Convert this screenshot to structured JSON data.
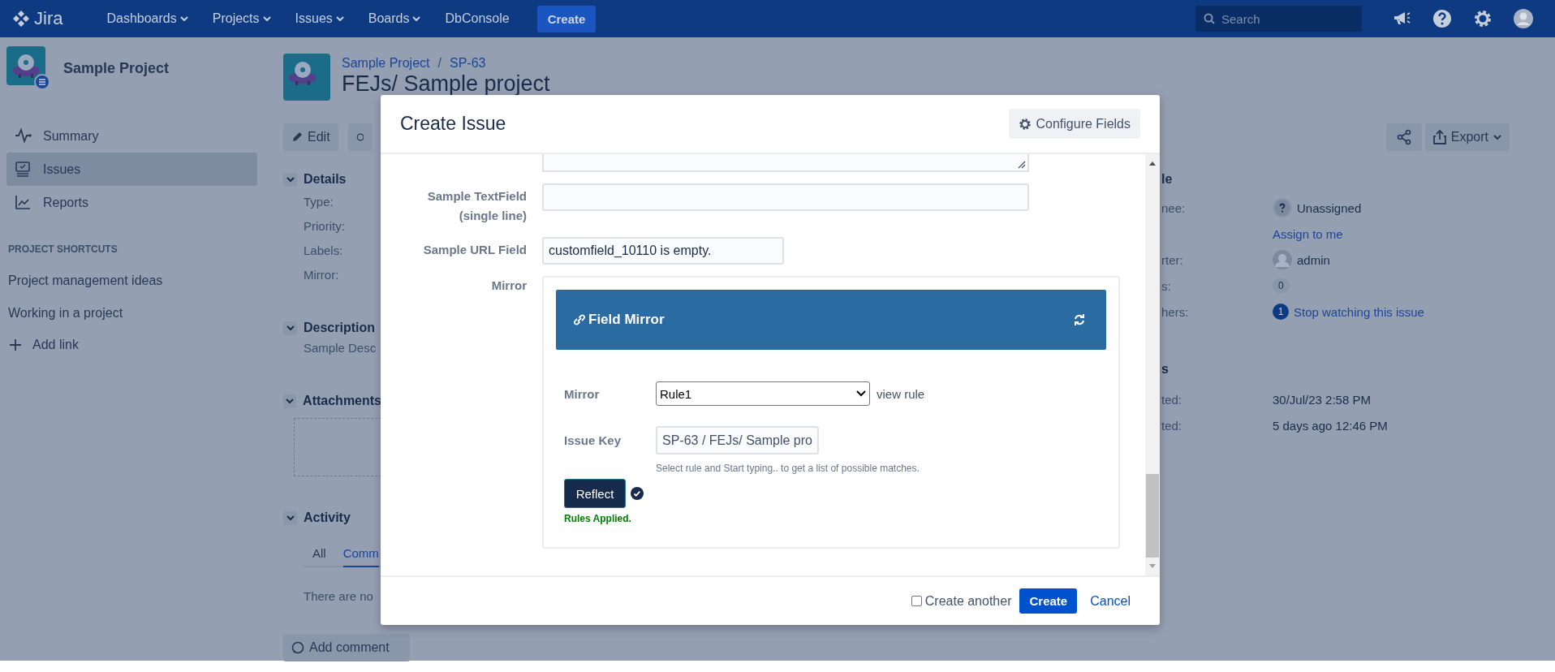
{
  "topbar": {
    "logo": "Jira",
    "nav": [
      {
        "label": "Dashboards",
        "dropdown": true
      },
      {
        "label": "Projects",
        "dropdown": true
      },
      {
        "label": "Issues",
        "dropdown": true
      },
      {
        "label": "Boards",
        "dropdown": true
      },
      {
        "label": "DbConsole",
        "dropdown": false
      }
    ],
    "create": "Create",
    "search": {
      "placeholder": "Search"
    }
  },
  "sidebar": {
    "project": "Sample Project",
    "items": [
      {
        "kind": "summary",
        "label": "Summary",
        "selected": false
      },
      {
        "kind": "issues",
        "label": "Issues",
        "selected": true
      },
      {
        "kind": "reports",
        "label": "Reports",
        "selected": false
      }
    ],
    "shortcuts_heading": "PROJECT SHORTCUTS",
    "shortcuts": [
      "Project management ideas",
      "Working in a project"
    ],
    "add_link": "Add link"
  },
  "issue": {
    "breadcrumbs": [
      "Sample Project",
      "SP-63"
    ],
    "separator": "/",
    "title": "FEJs/ Sample project",
    "edit": "Edit",
    "export": "Export",
    "details": {
      "heading": "Details",
      "labels": [
        "Type:",
        "Priority:",
        "Labels:",
        "Mirror:"
      ]
    },
    "description": {
      "heading": "Description",
      "text": "Sample Desc"
    },
    "attachments": {
      "heading": "Attachments"
    },
    "activity": {
      "heading": "Activity",
      "tabs": [
        {
          "label": "All",
          "selected": false
        },
        {
          "label": "Comm",
          "selected": true
        }
      ],
      "empty": "There are no"
    },
    "add_comment": "Add comment",
    "people": {
      "heading": "le",
      "rows": [
        {
          "kind": "unknown",
          "label": "nee:",
          "value": "Unassigned"
        },
        {
          "kind": "link",
          "value": "Assign to me"
        },
        {
          "kind": "user",
          "label": "rter:",
          "value": "admin"
        },
        {
          "kind": "count",
          "label": "s:",
          "value": "0"
        },
        {
          "kind": "watch",
          "label": "hers:",
          "count": "1",
          "value": "Stop watching this issue"
        }
      ]
    },
    "dates": {
      "heading": "s",
      "rows": [
        {
          "label": "ted:",
          "value": "30/Jul/23 2:58 PM"
        },
        {
          "label": "ted:",
          "value": "5 days ago 12:46 PM"
        }
      ]
    }
  },
  "dialog": {
    "title": "Create Issue",
    "configure": "Configure Fields",
    "fields": [
      {
        "kind": "textarea"
      },
      {
        "kind": "text",
        "label": "Sample TextField (single line)"
      },
      {
        "kind": "url",
        "label": "Sample URL Field",
        "value": "customfield_10110 is empty."
      },
      {
        "kind": "mirror",
        "label": "Mirror"
      }
    ],
    "mirror": {
      "title": "Field Mirror",
      "rule_label": "Mirror",
      "rule": "Rule1",
      "view_rule": "view rule",
      "key_label": "Issue Key",
      "key": "SP-63 / FEJs/ Sample pro",
      "hint": "Select rule and Start typing.. to get a list of possible matches.",
      "reflect": "Reflect",
      "status": "Rules Applied."
    },
    "create_another": {
      "label": "Create another",
      "checked": false
    },
    "submit": "Create",
    "cancel": "Cancel"
  }
}
